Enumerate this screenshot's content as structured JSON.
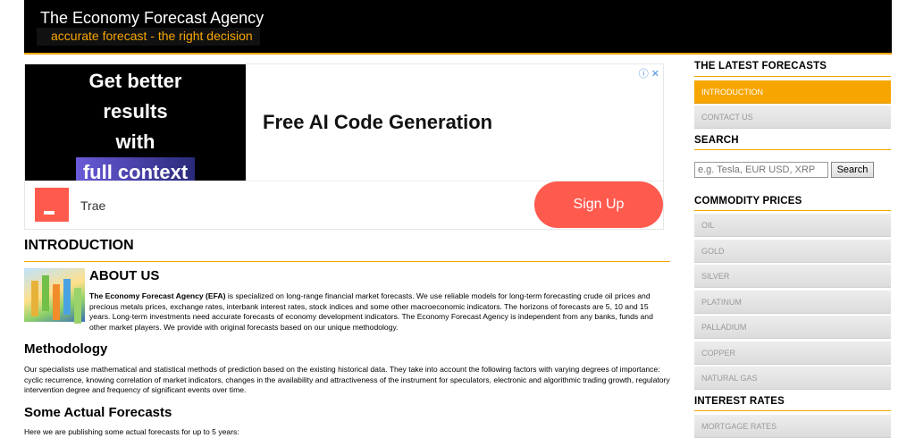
{
  "header": {
    "title": "The Economy Forecast Agency",
    "tagline": "accurate forecast - the right decision"
  },
  "ad": {
    "image_lines": [
      "Get better",
      "results",
      "with",
      "full context"
    ],
    "info_icons": "ⓘ ✕",
    "headline": "Free AI Code Generation",
    "brand": "Trae",
    "cta": "Sign Up",
    "colors": {
      "cta": "#ff5a4e"
    }
  },
  "main": {
    "page_title": "INTRODUCTION",
    "about_heading": "ABOUT US",
    "about_bold": "The Economy Forecast Agency (EFA)",
    "about_text": " is specialized on long-range financial market forecasts. We use reliable models for long-term forecasting crude oil prices and precious metals prices, exchange rates, interbank interest rates, stock indices and some other macroeconomic indicators. The horizons of forecasts are 5, 10 and 15 years. Long-term investments need accurate forecasts of economy development indicators. The Economy Forecast Agency is independent from any banks, funds and other market players. We provide with original forecasts based on our unique methodology.",
    "methodology_heading": "Methodology",
    "methodology_text": "Our specialists use mathematical and statistical methods of prediction based on the existing historical data. They take into account the following factors with varying degrees of importance: cyclic recurrence, knowing correlation of market indicators, changes in the availability and attractiveness of the instrument for speculators, electronic and algorithmic trading growth, regulatory intervention degree and frequency of significant events over time.",
    "forecasts_heading": "Some Actual Forecasts",
    "forecasts_text": "Here we are publishing some actual forecasts for up to 5 years:"
  },
  "sidebar": {
    "latest_heading": "THE LATEST FORECASTS",
    "latest_items": [
      "INTRODUCTION",
      "CONTACT US"
    ],
    "search_heading": "SEARCH",
    "search_placeholder": "e.g. Tesla, EUR USD, XRP",
    "search_button": "Search",
    "commodity_heading": "COMMODITY PRICES",
    "commodity_items": [
      "OIL",
      "GOLD",
      "SILVER",
      "PLATINUM",
      "PALLADIUM",
      "COPPER",
      "NATURAL GAS"
    ],
    "interest_heading": "INTEREST RATES",
    "interest_items": [
      "MORTGAGE RATES"
    ]
  },
  "colors": {
    "accent": "#f7a500",
    "header_bg": "#000000"
  }
}
